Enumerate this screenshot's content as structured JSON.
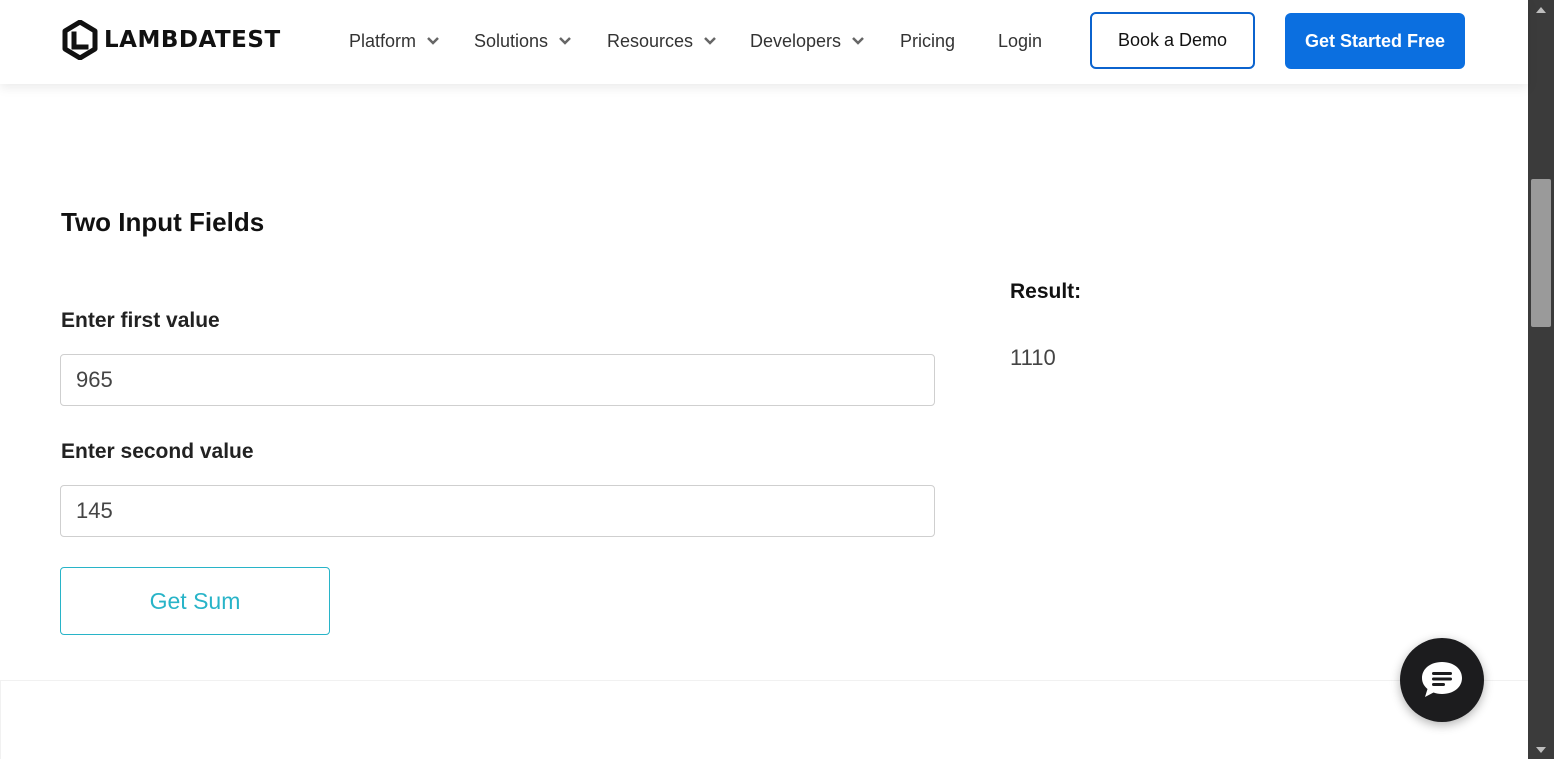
{
  "header": {
    "logo_text": "LAMBDATEST",
    "nav": [
      {
        "label": "Platform",
        "dropdown": true
      },
      {
        "label": "Solutions",
        "dropdown": true
      },
      {
        "label": "Resources",
        "dropdown": true
      },
      {
        "label": "Developers",
        "dropdown": true
      },
      {
        "label": "Pricing",
        "dropdown": false
      },
      {
        "label": "Login",
        "dropdown": false
      }
    ],
    "book_demo_label": "Book a Demo",
    "get_started_label": "Get Started Free"
  },
  "main": {
    "title": "Two Input Fields",
    "first_label": "Enter first value",
    "first_value": "965",
    "second_label": "Enter second value",
    "second_value": "145",
    "sum_button_label": "Get Sum",
    "result_label": "Result:",
    "result_value": "1110"
  },
  "colors": {
    "primary_blue": "#0b6fe0",
    "demo_border": "#0b63ce",
    "teal": "#28b4c8",
    "chat_bg": "#1c1c1e"
  },
  "icons": {
    "logo": "lambdatest-logo-icon",
    "chevron": "chevron-down-icon",
    "chat": "chat-bubble-icon"
  }
}
